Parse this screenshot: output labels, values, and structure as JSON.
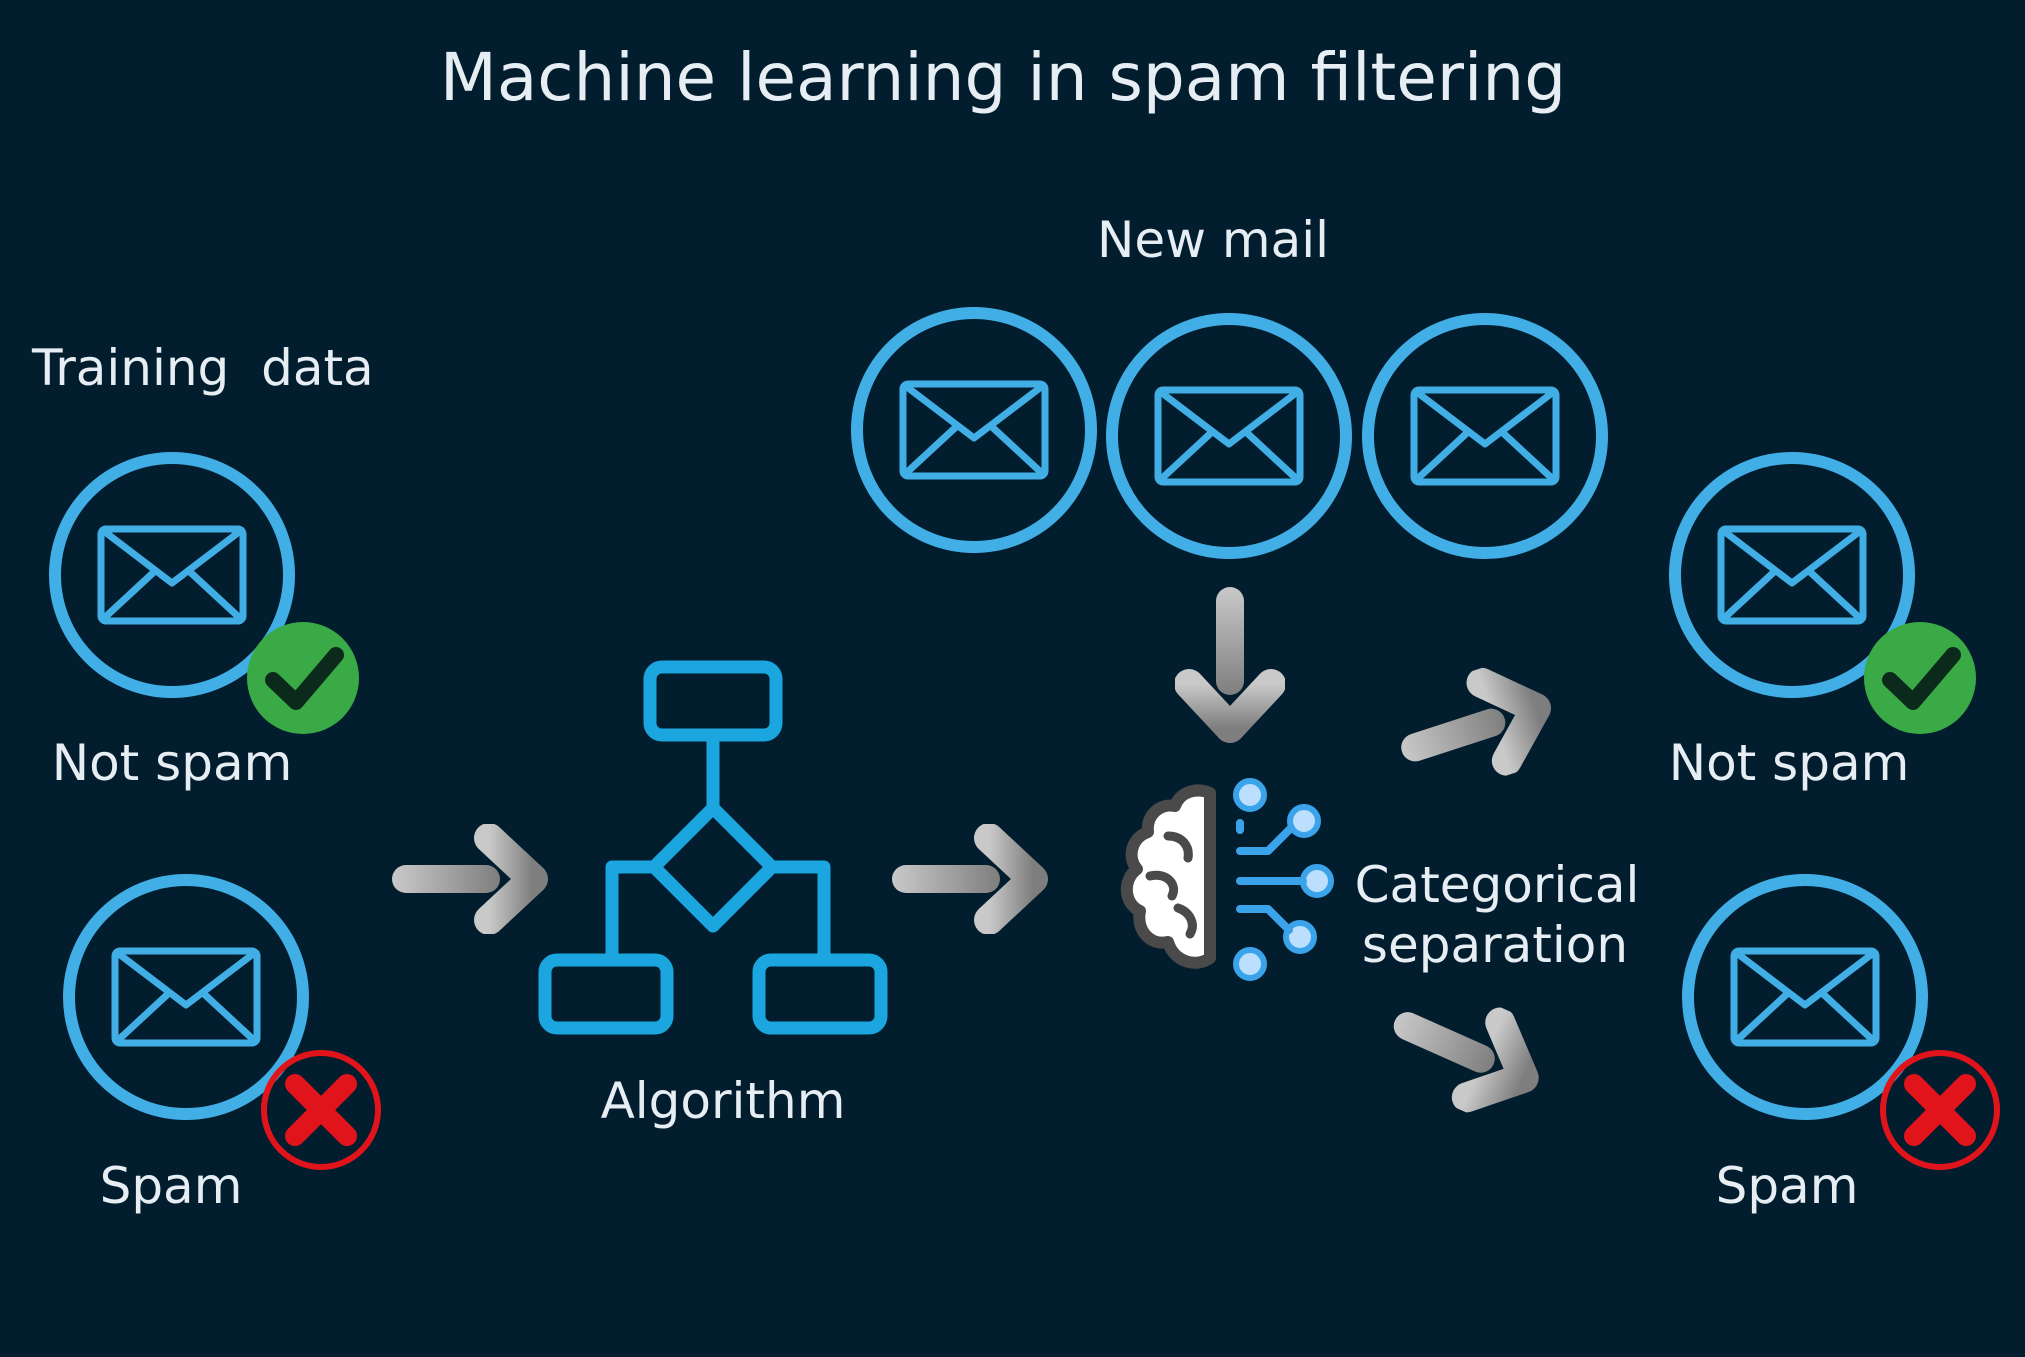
{
  "diagram": {
    "title": "Machine learning in spam filtering",
    "training": {
      "heading": "Training  data",
      "not_spam_label": "Not spam",
      "spam_label": "Spam"
    },
    "algorithm_label": "Algorithm",
    "new_mail_label": "New mail",
    "separation": {
      "line1": "Categorical",
      "line2": "separation"
    },
    "output": {
      "not_spam_label": "Not spam",
      "spam_label": "Spam"
    }
  },
  "colors": {
    "background": "#021d2d",
    "ring": "#41afe6",
    "algorithm": "#1ba6e0",
    "check_badge": "#3aaa47",
    "cross_badge": "#e2141b",
    "arrow": "#8f8f8f",
    "text": "#e6edf3"
  },
  "icons": {
    "mail": "envelope-icon",
    "ok": "checkmark-icon",
    "bad": "cross-icon",
    "model": "ai-brain-icon",
    "algorithm": "flowchart-icon",
    "flow": "arrow-icon"
  }
}
